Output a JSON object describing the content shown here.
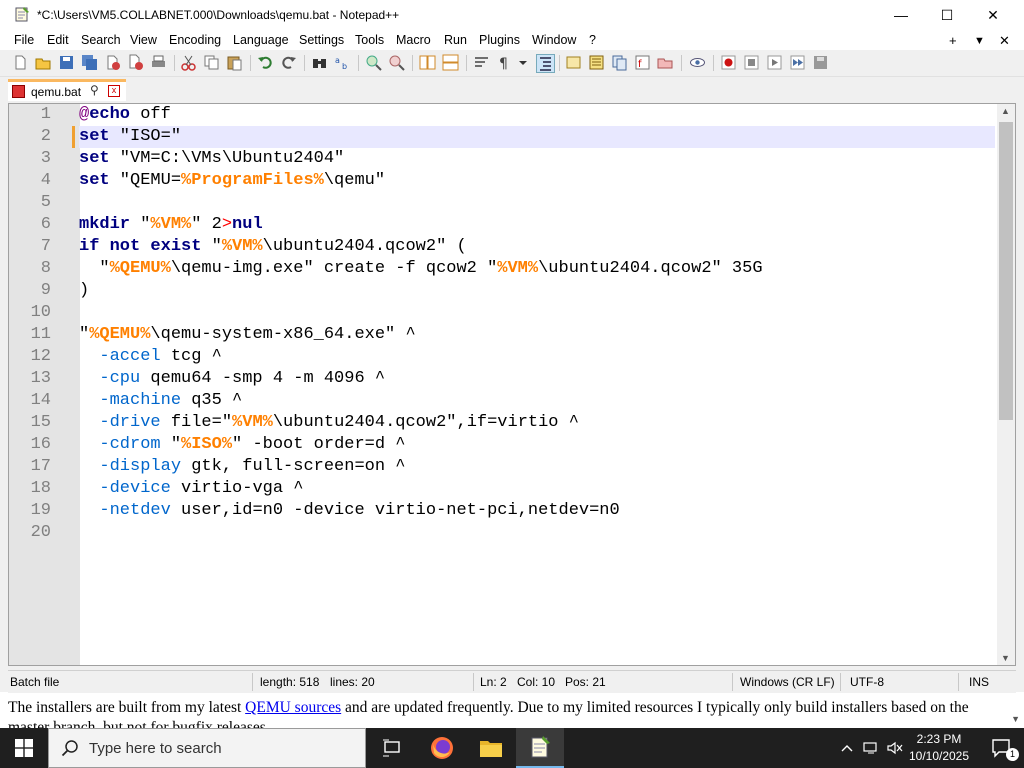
{
  "window": {
    "title": "*C:\\Users\\VM5.COLLABNET.000\\Downloads\\qemu.bat - Notepad++",
    "minimize_glyph": "—",
    "maximize_glyph": "☐",
    "close_glyph": "✕"
  },
  "menu": {
    "items": [
      "File",
      "Edit",
      "Search",
      "View",
      "Encoding",
      "Language",
      "Settings",
      "Tools",
      "Macro",
      "Run",
      "Plugins",
      "Window",
      "?"
    ],
    "right": [
      "+",
      "▼",
      "✕"
    ]
  },
  "tab": {
    "label": "qemu.bat",
    "pin_glyph": "⚲",
    "close_glyph": "x"
  },
  "editor": {
    "current_line": 2,
    "lines": [
      {
        "n": "1",
        "segments": [
          {
            "t": "@",
            "c": "at"
          },
          {
            "t": "echo",
            "c": "k"
          },
          {
            "t": " off",
            "c": ""
          }
        ]
      },
      {
        "n": "2",
        "segments": [
          {
            "t": "set",
            "c": "k"
          },
          {
            "t": " \"ISO=\"",
            "c": ""
          }
        ]
      },
      {
        "n": "3",
        "segments": [
          {
            "t": "set",
            "c": "k"
          },
          {
            "t": " \"VM=C:\\VMs\\Ubuntu2404\"",
            "c": ""
          }
        ]
      },
      {
        "n": "4",
        "segments": [
          {
            "t": "set",
            "c": "k"
          },
          {
            "t": " \"QEMU=",
            "c": ""
          },
          {
            "t": "%ProgramFiles%",
            "c": "v"
          },
          {
            "t": "\\qemu\"",
            "c": ""
          }
        ]
      },
      {
        "n": "5",
        "segments": []
      },
      {
        "n": "6",
        "segments": [
          {
            "t": "mkdir",
            "c": "k"
          },
          {
            "t": " \"",
            "c": ""
          },
          {
            "t": "%VM%",
            "c": "v"
          },
          {
            "t": "\" 2",
            "c": ""
          },
          {
            "t": ">",
            "c": "o"
          },
          {
            "t": "nul",
            "c": "k"
          }
        ]
      },
      {
        "n": "7",
        "segments": [
          {
            "t": "if not exist",
            "c": "k"
          },
          {
            "t": " \"",
            "c": ""
          },
          {
            "t": "%VM%",
            "c": "v"
          },
          {
            "t": "\\ubuntu2404.qcow2\" (",
            "c": ""
          }
        ]
      },
      {
        "n": "8",
        "segments": [
          {
            "t": "  \"",
            "c": ""
          },
          {
            "t": "%QEMU%",
            "c": "v"
          },
          {
            "t": "\\qemu-img.exe\" create -f qcow2 \"",
            "c": ""
          },
          {
            "t": "%VM%",
            "c": "v"
          },
          {
            "t": "\\ubuntu2404.qcow2\" 35G",
            "c": ""
          }
        ]
      },
      {
        "n": "9",
        "segments": [
          {
            "t": ")",
            "c": ""
          }
        ]
      },
      {
        "n": "10",
        "segments": []
      },
      {
        "n": "11",
        "segments": [
          {
            "t": "\"",
            "c": ""
          },
          {
            "t": "%QEMU%",
            "c": "v"
          },
          {
            "t": "\\qemu-system-x86_64.exe\" ^",
            "c": ""
          }
        ]
      },
      {
        "n": "12",
        "segments": [
          {
            "t": "  ",
            "c": ""
          },
          {
            "t": "-accel",
            "c": "sw"
          },
          {
            "t": " tcg ^",
            "c": ""
          }
        ]
      },
      {
        "n": "13",
        "segments": [
          {
            "t": "  ",
            "c": ""
          },
          {
            "t": "-cpu",
            "c": "sw"
          },
          {
            "t": " qemu64 -smp 4 -m 4096 ^",
            "c": ""
          }
        ]
      },
      {
        "n": "14",
        "segments": [
          {
            "t": "  ",
            "c": ""
          },
          {
            "t": "-machine",
            "c": "sw"
          },
          {
            "t": " q35 ^",
            "c": ""
          }
        ]
      },
      {
        "n": "15",
        "segments": [
          {
            "t": "  ",
            "c": ""
          },
          {
            "t": "-drive",
            "c": "sw"
          },
          {
            "t": " file=\"",
            "c": ""
          },
          {
            "t": "%VM%",
            "c": "v"
          },
          {
            "t": "\\ubuntu2404.qcow2\",if=virtio ^",
            "c": ""
          }
        ]
      },
      {
        "n": "16",
        "segments": [
          {
            "t": "  ",
            "c": ""
          },
          {
            "t": "-cdrom",
            "c": "sw"
          },
          {
            "t": " \"",
            "c": ""
          },
          {
            "t": "%ISO%",
            "c": "v"
          },
          {
            "t": "\" -boot order=d ^",
            "c": ""
          }
        ]
      },
      {
        "n": "17",
        "segments": [
          {
            "t": "  ",
            "c": ""
          },
          {
            "t": "-display",
            "c": "sw"
          },
          {
            "t": " gtk, full-screen=on ^",
            "c": ""
          }
        ]
      },
      {
        "n": "18",
        "segments": [
          {
            "t": "  ",
            "c": ""
          },
          {
            "t": "-device",
            "c": "sw"
          },
          {
            "t": " virtio-vga ^",
            "c": ""
          }
        ]
      },
      {
        "n": "19",
        "segments": [
          {
            "t": "  ",
            "c": ""
          },
          {
            "t": "-netdev",
            "c": "sw"
          },
          {
            "t": " user,id=n0 -device virtio-net-pci,netdev=n0",
            "c": ""
          }
        ]
      },
      {
        "n": "20",
        "segments": []
      }
    ]
  },
  "status": {
    "file_type": "Batch file",
    "length": "length: 518",
    "lines": "lines: 20",
    "ln": "Ln: 2",
    "col": "Col: 10",
    "pos": "Pos: 21",
    "eol": "Windows (CR LF)",
    "encoding": "UTF-8",
    "mode": "INS"
  },
  "background_page": {
    "text_before": "The installers are built from my latest ",
    "link": "QEMU sources",
    "text_after": " and are updated frequently. Due to my limited resources I typically only build installers based on the master branch, but not for bugfix releases."
  },
  "taskbar": {
    "search_placeholder": "Type here to search",
    "time": "2:23 PM",
    "date": "10/10/2025",
    "notification_count": "1"
  },
  "colors": {
    "keyword": "#00007f",
    "variable": "#ff8000",
    "switch": "#0066cc",
    "current_line": "#e8e8ff",
    "tab_accent": "#fab860"
  }
}
